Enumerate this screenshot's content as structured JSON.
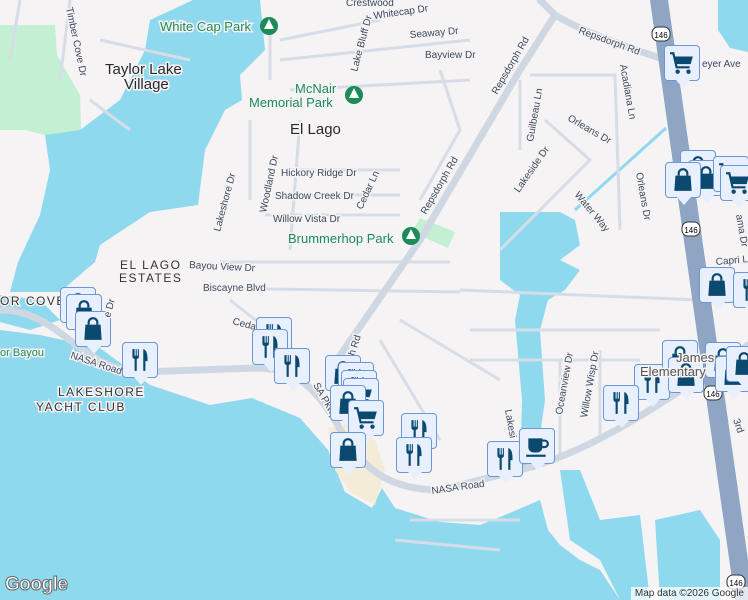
{
  "map": {
    "places": {
      "taylor_lake_1": "Taylor Lake",
      "taylor_lake_2": "Village",
      "el_lago": "El Lago",
      "el_lago_estates_1": "EL LAGO",
      "el_lago_estates_2": "ESTATES",
      "lakeshore_yc_1": "LAKESHORE",
      "lakeshore_yc_2": "YACHT CLUB",
      "harbor_cove": "OR COVE",
      "bayou": "or Bayou",
      "school_1": "James",
      "school_2": "Elementary"
    },
    "parks": {
      "white_cap": "White Cap Park",
      "mcnair_1": "McNair",
      "mcnair_2": "Memorial Park",
      "brummerhop": "Brummerhop Park"
    },
    "streets": {
      "crestwood": "Crestwood",
      "whitecap": "Whitecap Dr",
      "seaway": "Seaway Dr",
      "bayview": "Bayview Dr",
      "timber_cove": "Timber Cove Dr",
      "lake_bluff": "Lake Bluff Dr",
      "repsdorph_1": "Repsdorph Rd",
      "repsdorph_2": "Repsdorph Rd",
      "repsdorph_3": "Repsdorph Rd",
      "repsdorph_4": "orph Rd",
      "meyer": "eyer Ave",
      "acadiana": "Acadiana Ln",
      "guilbeau": "Guilbeau Ln",
      "orleans_1": "Orleans Dr",
      "orleans_2": "Orleans Dr",
      "lakeside": "Lakeside Dr",
      "water_way": "Water Way",
      "hickory": "Hickory Ridge Dr",
      "shadow": "Shadow Creek Dr",
      "willow_vista": "Willow Vista Dr",
      "woodland": "Woodland Dr",
      "lakeshore": "Lakeshore Dr",
      "cedar": "Cedar Ln",
      "cedar_2": "Ceda",
      "bayou_view": "Bayou View Dr",
      "biscayne": "Biscayne Blvd",
      "nasa_1": "NASA Road",
      "nasa_2": "NASA Road",
      "nasa_pkwy": "SA Pkwy",
      "oceanview": "Oceanview Dr",
      "willow_wisp": "Willow Wisp Dr",
      "lakeside_2": "Lakesi",
      "capri": "Capri L",
      "bahama": "ama Dr",
      "third": "3rd",
      "e_dr": "e Dr"
    },
    "route_shields": [
      "146",
      "146",
      "146",
      "146"
    ],
    "poi_types": [
      "shopping-bag-icon",
      "restaurant-icon",
      "shopping-cart-icon",
      "coffee-icon"
    ],
    "colors": {
      "water": "#8fd9ee",
      "land": "#f5f3f4",
      "park": "#c3efd3",
      "highway": "#8fa5c4",
      "pin_icon": "#0b4a6e",
      "park_text": "#1e8a5a"
    }
  },
  "branding": {
    "logo": "Google",
    "attribution": "Map data ©2026 Google"
  }
}
